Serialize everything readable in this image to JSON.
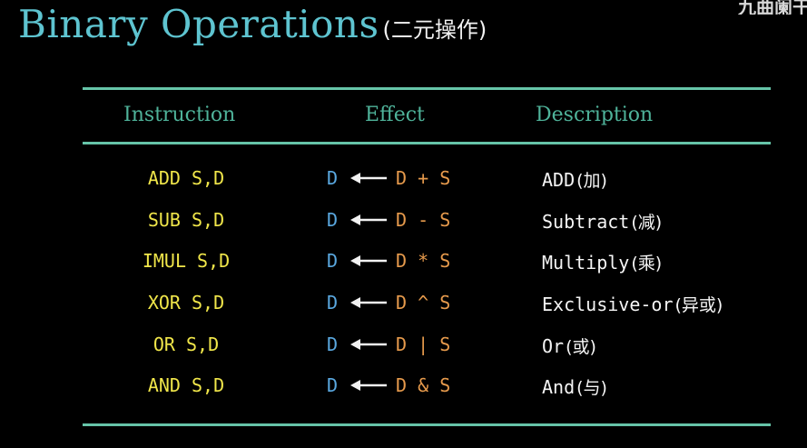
{
  "title": {
    "main": "Binary Operations",
    "subtitle": "(二元操作)"
  },
  "watermark": "九曲阑干",
  "table": {
    "headers": {
      "instruction": "Instruction",
      "effect": "Effect",
      "description": "Description"
    },
    "rows": [
      {
        "instruction": "ADD S,D",
        "dest": "D",
        "expr": "D + S",
        "desc": "ADD",
        "desc_zh": "(加)"
      },
      {
        "instruction": "SUB S,D",
        "dest": "D",
        "expr": "D - S",
        "desc": "Subtract",
        "desc_zh": "(减)"
      },
      {
        "instruction": "IMUL S,D",
        "dest": "D",
        "expr": "D * S",
        "desc": "Multiply",
        "desc_zh": "(乘)"
      },
      {
        "instruction": "XOR S,D",
        "dest": "D",
        "expr": "D ^ S",
        "desc": "Exclusive-or",
        "desc_zh": "(异或)"
      },
      {
        "instruction": "OR S,D",
        "dest": "D",
        "expr": "D | S",
        "desc": "Or",
        "desc_zh": "(或)"
      },
      {
        "instruction": "AND S,D",
        "dest": "D",
        "expr": "D & S",
        "desc": "And",
        "desc_zh": "(与)"
      }
    ]
  },
  "colors": {
    "title": "#5ec4d0",
    "rule": "#66c4a8",
    "header": "#4fb39a",
    "instruction": "#f0e64a",
    "dest": "#5aa8e0",
    "expr": "#e69a4c",
    "description": "#f5f5f5"
  }
}
